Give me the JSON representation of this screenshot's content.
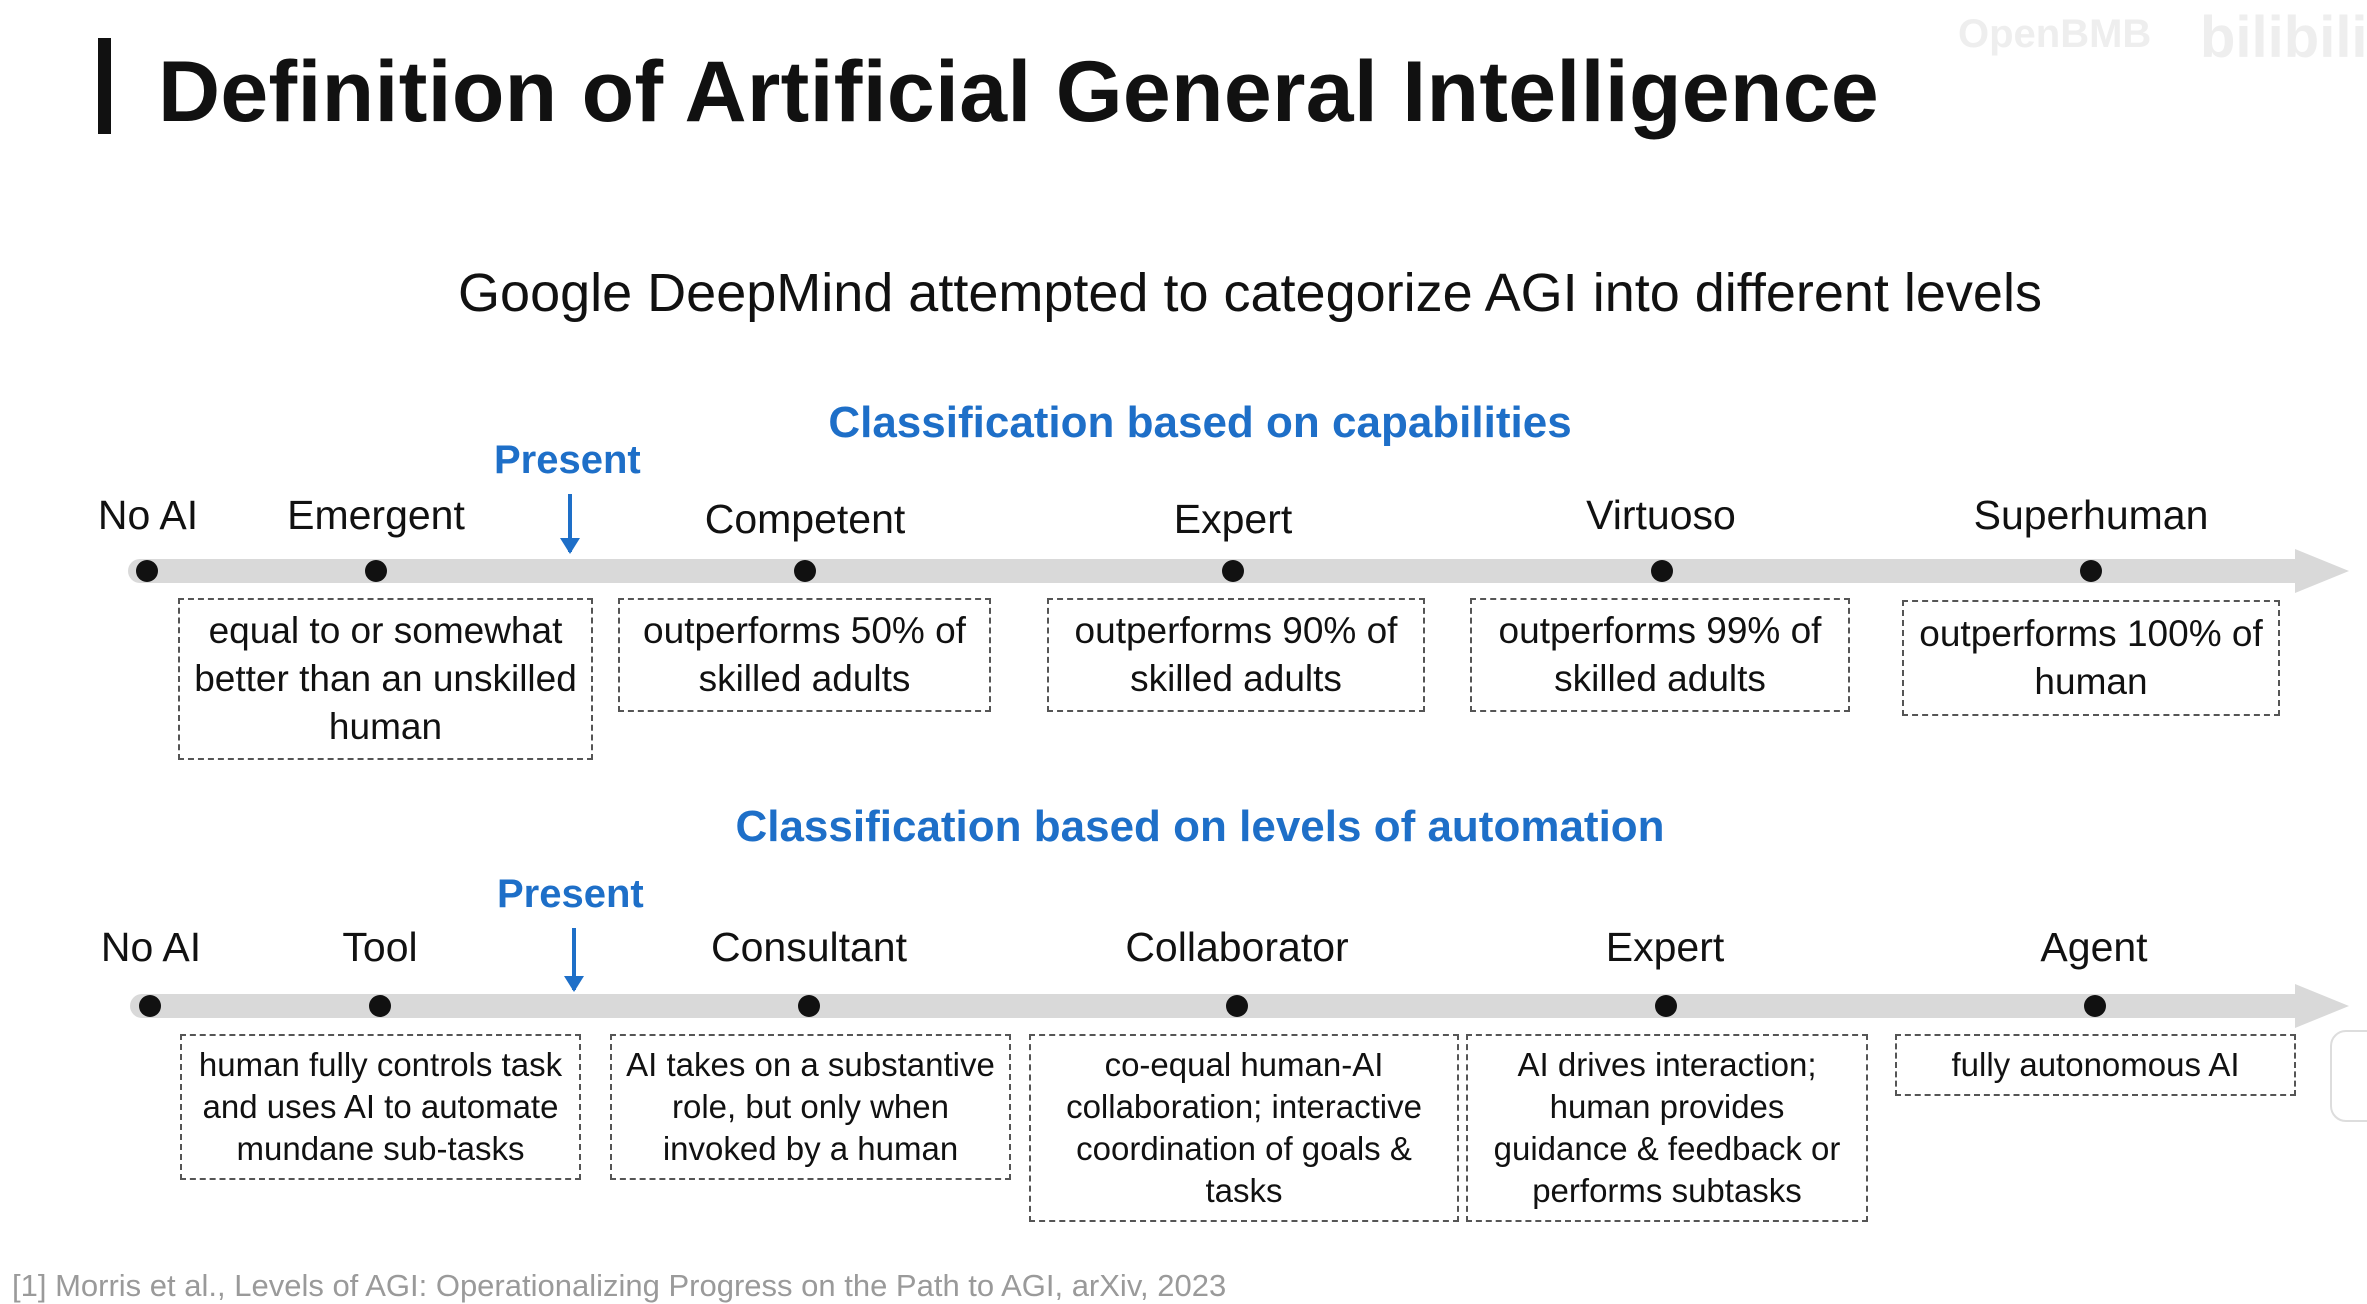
{
  "title": "Definition of Artificial General Intelligence",
  "watermark": {
    "text1": "OpenBMB",
    "text2": "bilibili"
  },
  "subtitle": "Google DeepMind attempted to categorize AGI into different levels",
  "capabilities": {
    "heading": "Classification based on capabilities",
    "present_label": "Present",
    "levels": [
      {
        "name": "No AI",
        "desc": ""
      },
      {
        "name": "Emergent",
        "desc": "equal to or somewhat better than an unskilled human"
      },
      {
        "name": "Competent",
        "desc": "outperforms 50% of skilled adults"
      },
      {
        "name": "Expert",
        "desc": "outperforms 90% of skilled adults"
      },
      {
        "name": "Virtuoso",
        "desc": "outperforms 99% of skilled adults"
      },
      {
        "name": "Superhuman",
        "desc": "outperforms 100% of human"
      }
    ]
  },
  "automation": {
    "heading": "Classification based on levels of automation",
    "present_label": "Present",
    "levels": [
      {
        "name": "No AI",
        "desc": ""
      },
      {
        "name": "Tool",
        "desc": "human fully controls task and uses AI to automate mundane sub-tasks"
      },
      {
        "name": "Consultant",
        "desc": "AI takes on a substantive role, but only when invoked by a human"
      },
      {
        "name": "Collaborator",
        "desc": "co-equal human-AI collaboration; interactive coordination of goals & tasks"
      },
      {
        "name": "Expert",
        "desc": "AI drives interaction; human provides guidance & feedback or performs subtasks"
      },
      {
        "name": "Agent",
        "desc": "fully autonomous AI"
      }
    ]
  },
  "footnote": "[1] Morris et al., Levels of AGI: Operationalizing Progress on the Path to AGI, arXiv, 2023"
}
